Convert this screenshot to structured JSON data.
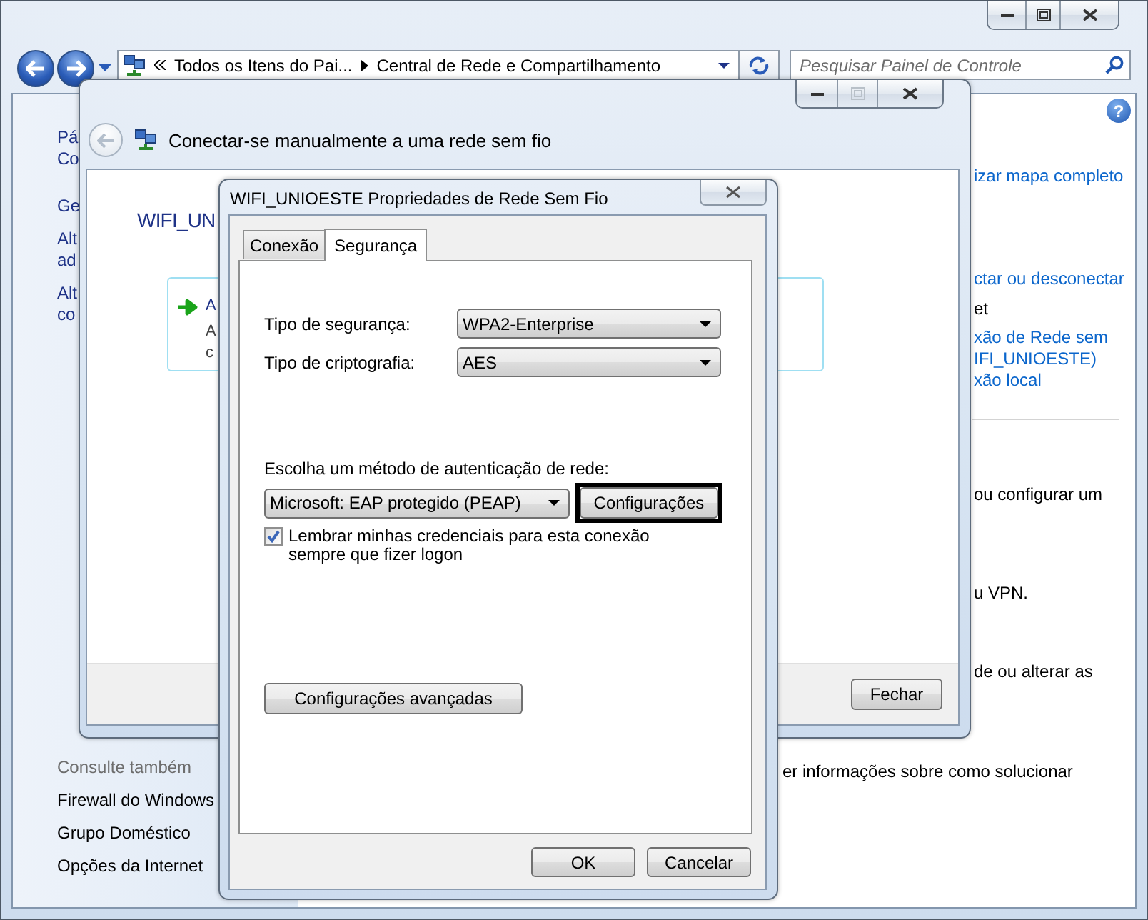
{
  "explorer": {
    "address_bar": {
      "segments": [
        "Todos os Itens do Pai...",
        "Central de Rede e Compartilhamento"
      ]
    },
    "search": {
      "placeholder": "Pesquisar Painel de Controle"
    },
    "help": "?",
    "sidebar": {
      "tasks": [
        [
          "Pá",
          "Co"
        ],
        [
          "Ge"
        ],
        [
          "Alt",
          "ad"
        ],
        [
          "Alt",
          "co"
        ]
      ],
      "see_also_title": "Consulte também",
      "see_also": [
        "Firewall do Windows",
        "Grupo Doméstico",
        "Opções da Internet"
      ]
    },
    "main_fragments": [
      {
        "text": "izar mapa completo",
        "kind": "link"
      },
      {
        "text": "ctar ou desconectar",
        "kind": "link"
      },
      {
        "text": "et",
        "kind": "text"
      },
      {
        "text": "xão de Rede sem",
        "kind": "link"
      },
      {
        "text": "IFI_UNIOESTE)",
        "kind": "link"
      },
      {
        "text": "xão local",
        "kind": "link"
      },
      {
        "text": "ou configurar um",
        "kind": "text"
      },
      {
        "text": "u VPN.",
        "kind": "text"
      },
      {
        "text": "de ou alterar as",
        "kind": "text"
      },
      {
        "text": "er informações sobre como solucionar",
        "kind": "text"
      }
    ]
  },
  "wizard": {
    "title": "Conectar-se manualmente a uma rede sem fio",
    "network_name": "WIFI_UN",
    "option_lines": [
      "A",
      "A",
      "c"
    ],
    "close_button": "Fechar"
  },
  "dialog": {
    "title": "WIFI_UNIOESTE Propriedades de Rede Sem Fio",
    "tabs": [
      {
        "label": "Conexão",
        "selected": false
      },
      {
        "label": "Segurança",
        "selected": true
      }
    ],
    "fields": [
      {
        "label": "Tipo de segurança:",
        "value": "WPA2-Enterprise"
      },
      {
        "label": "Tipo de criptografia:",
        "value": "AES"
      }
    ],
    "auth_label": "Escolha um método de autenticação de rede:",
    "auth_method": "Microsoft: EAP protegido (PEAP)",
    "auth_settings_button": {
      "label": "Configurações",
      "focused": true
    },
    "remember": {
      "label": "Lembrar minhas credenciais para esta conexão sempre que fizer logon",
      "checked": true
    },
    "advanced_button": "Configurações avançadas",
    "buttons": [
      "OK",
      "Cancelar"
    ]
  }
}
